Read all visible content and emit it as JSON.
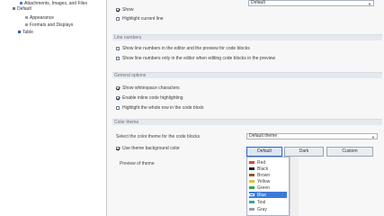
{
  "tree": {
    "items": [
      {
        "label": "Attachments, Images, and Files"
      },
      {
        "label": "Default"
      },
      {
        "label": "Appearance"
      },
      {
        "label": "Formats and Displays"
      },
      {
        "label": "Table"
      }
    ]
  },
  "top": {
    "dropdown_value": "Default",
    "checkbox_1_label": "Show",
    "checkbox_2_label": "Highlight current line"
  },
  "sections": {
    "line_numbers": "Line numbers",
    "general": "General options",
    "color_theme": "Color theme"
  },
  "line_number_options": [
    {
      "label": "Show line numbers in the editor and the preview for code blocks",
      "checked": false
    },
    {
      "label": "Show line numbers only in the editor when editing code blocks in the preview",
      "checked": false
    }
  ],
  "general_options": [
    {
      "label": "Show whitespace characters",
      "checked": true
    },
    {
      "label": "Enable inline code highlighting",
      "checked": true
    },
    {
      "label": "Highlight the whole row in the code block",
      "checked": false
    }
  ],
  "theme": {
    "label": "Select the color theme for the code blocks",
    "dropdown_value": "Default theme",
    "checkbox_label": "Use theme background color",
    "checkbox_checked": true,
    "preview_label": "Preview of theme",
    "tabs": [
      {
        "label": "Default",
        "active": true
      },
      {
        "label": "Dark"
      },
      {
        "label": "Custom"
      }
    ],
    "colors": [
      {
        "name": "Red",
        "color": "#d84a3a"
      },
      {
        "name": "Black",
        "color": "#222222"
      },
      {
        "name": "Brown",
        "color": "#8a5a2b"
      },
      {
        "name": "Yellow",
        "color": "#e2c12a"
      },
      {
        "name": "Green",
        "color": "#38a64a"
      },
      {
        "name": "Blue",
        "color": "#2d63c8",
        "selected": true
      },
      {
        "name": "Teal",
        "color": "#35a7a1"
      },
      {
        "name": "Gray",
        "color": "#9aa0a6"
      }
    ]
  }
}
